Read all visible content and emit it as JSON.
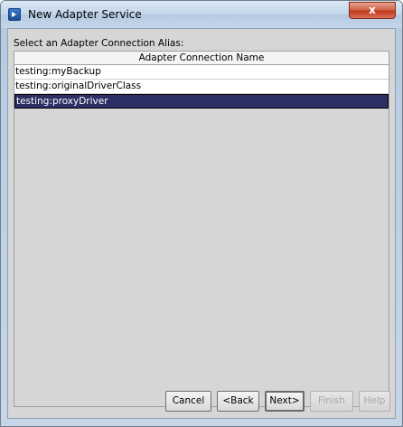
{
  "window": {
    "title": "New Adapter Service",
    "close_label": "x"
  },
  "panel": {
    "label": "Select an Adapter Connection Alias:"
  },
  "table": {
    "header": "Adapter Connection Name",
    "rows": [
      "testing:myBackup",
      "testing:originalDriverClass",
      "testing:proxyDriver"
    ],
    "selected_index": 2
  },
  "buttons": {
    "cancel": "Cancel",
    "back": "<Back",
    "next": "Next>",
    "finish": "Finish",
    "help": "Help"
  }
}
